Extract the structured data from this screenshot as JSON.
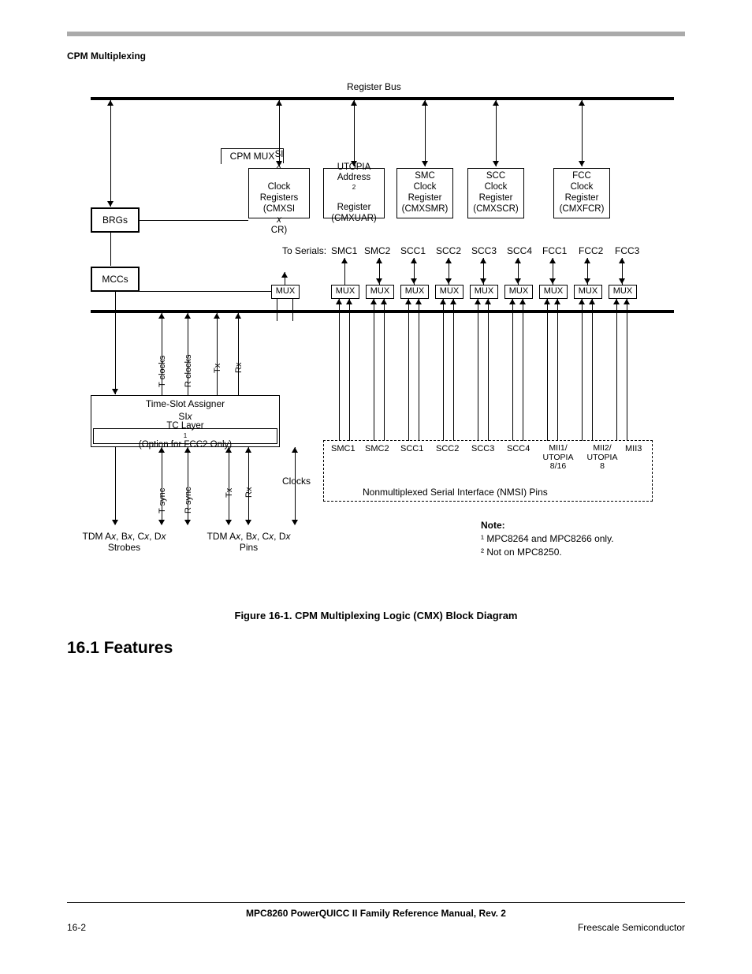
{
  "header": {
    "running": "CPM Multiplexing"
  },
  "diagram": {
    "top_label": "Register Bus",
    "cpm_mux": "CPM MUX",
    "brgs": "BRGs",
    "mccs": "MCCs",
    "reg_six": "SIx\nClock\nRegisters\n(CMXSIxCR)",
    "reg_utopia": "UTOPIA\nAddress\nRegister\n(CMXUAR)",
    "reg_smc": "SMC\nClock\nRegister\n(CMXSMR)",
    "reg_scc": "SCC\nClock\nRegister\n(CMXSCR)",
    "reg_fcc": "FCC\nClock\nRegister\n(CMXFCR)",
    "to_serials": "To Serials:",
    "serials": [
      "SMC1",
      "SMC2",
      "SCC1",
      "SCC2",
      "SCC3",
      "SCC4",
      "FCC1",
      "FCC2",
      "FCC3"
    ],
    "mux": "MUX",
    "tc_label": "T clocks",
    "rc_label": "R clocks",
    "tx": "Tx",
    "rx": "Rx",
    "tsa_title": "Time-Slot Assigner\nSIx",
    "tc_layer": "TC Layer¹ (Option for FCC2 Only)",
    "t_sync": "T sync",
    "r_sync": "R sync",
    "clocks": "Clocks",
    "nmsi_items": [
      "SMC1",
      "SMC2",
      "SCC1",
      "SCC2",
      "SCC3",
      "SCC4",
      "MII1/\nUTOPIA\n8/16",
      "MII2/\nUTOPIA\n8",
      "MII3"
    ],
    "nmsi_label": "Nonmultiplexed Serial Interface (NMSI) Pins",
    "strobes_l1": "TDM Ax, Bx, Cx, Dx",
    "strobes_l2": "Strobes",
    "pins_l1": "TDM Ax, Bx, Cx, Dx",
    "pins_l2": "Pins",
    "note_title": "Note:",
    "note1": "¹ MPC8264 and MPC8266 only.",
    "note2": "² Not on MPC8250."
  },
  "caption": "Figure 16-1. CPM Multiplexing Logic (CMX) Block Diagram",
  "section": "16.1   Features",
  "footer": {
    "doc": "MPC8260 PowerQUICC II Family Reference Manual, Rev. 2",
    "left": "16-2",
    "right": "Freescale Semiconductor"
  }
}
